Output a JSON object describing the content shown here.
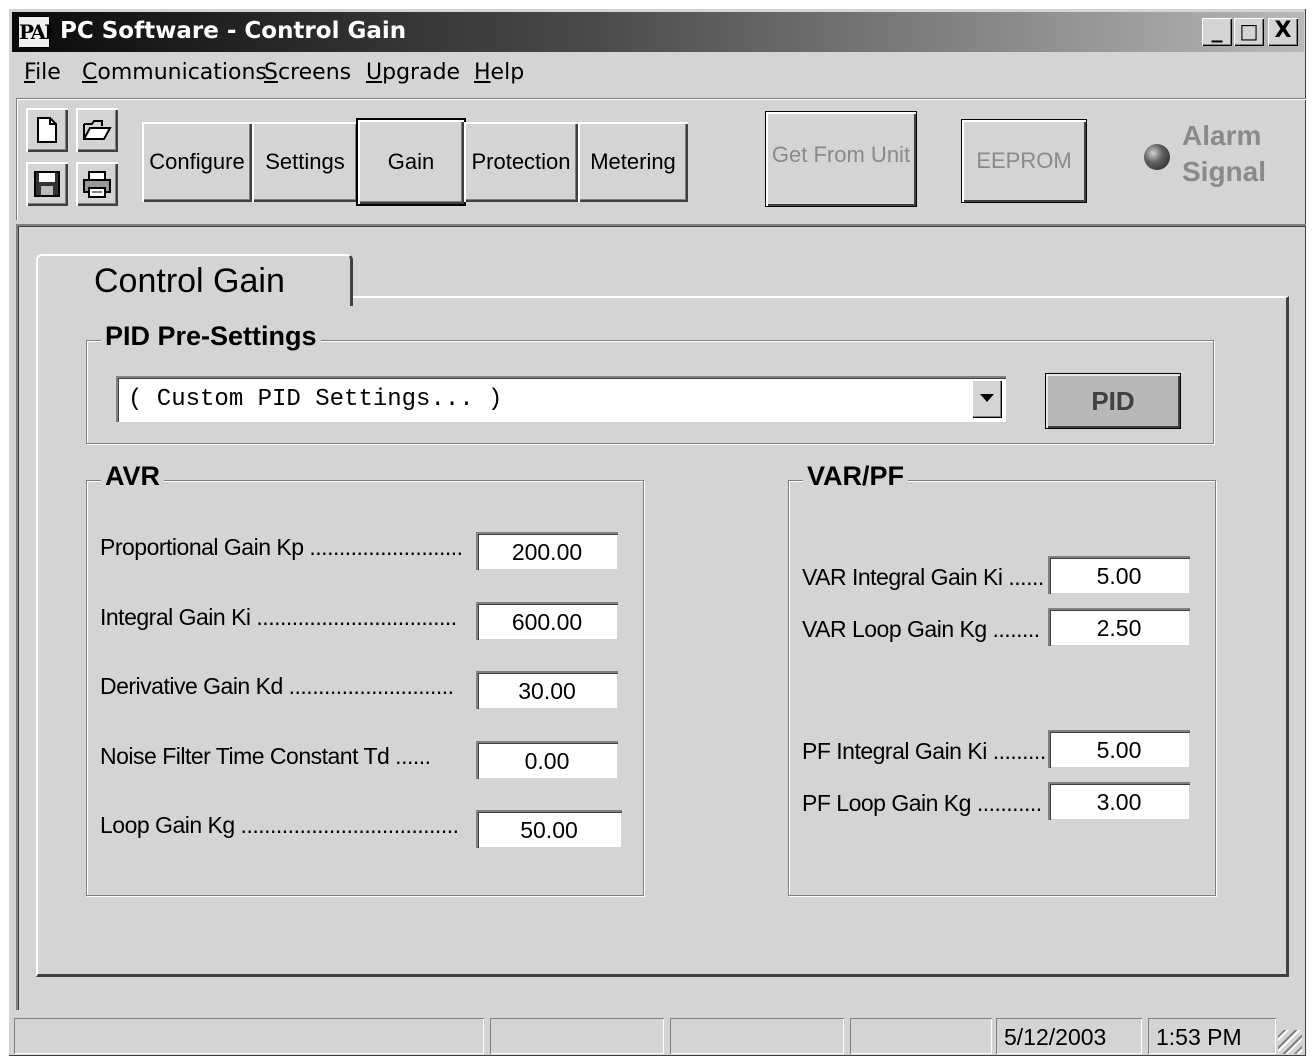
{
  "window": {
    "title": "PC Software - Control Gain",
    "icon_text": "PAI",
    "controls": {
      "minimize": "_",
      "maximize": "□",
      "close": "X"
    }
  },
  "menu": [
    {
      "label_first": "F",
      "label_rest": "ile"
    },
    {
      "label_first": "C",
      "label_rest": "ommunications"
    },
    {
      "label_first": "S",
      "label_rest": "creens"
    },
    {
      "label_first": "U",
      "label_rest": "pgrade"
    },
    {
      "label_first": "H",
      "label_rest": "elp"
    }
  ],
  "toolbar": {
    "icons": [
      "new-file-icon",
      "open-folder-icon",
      "save-disk-icon",
      "printer-icon"
    ],
    "nav_buttons": [
      "Configure",
      "Settings",
      "Gain",
      "Protection",
      "Metering"
    ],
    "active_nav": "Gain",
    "get_from_unit": "Get From Unit",
    "eeprom": "EEPROM",
    "alarm_line1": "Alarm",
    "alarm_line2": "Signal"
  },
  "tab": {
    "label": "Control Gain"
  },
  "pid_presettings": {
    "group_label": "PID Pre-Settings",
    "selected": "( Custom PID Settings... )",
    "button": "PID"
  },
  "avr": {
    "group_label": "AVR",
    "fields": [
      {
        "label": "Proportional Gain Kp ..........................",
        "value": "200.00"
      },
      {
        "label": "Integral Gain Ki ..................................",
        "value": "600.00"
      },
      {
        "label": "Derivative Gain Kd ............................",
        "value": "30.00"
      },
      {
        "label": "Noise Filter Time Constant Td ......",
        "value": "0.00"
      },
      {
        "label": "Loop Gain Kg .....................................",
        "value": "50.00"
      }
    ]
  },
  "varpf": {
    "group_label": "VAR/PF",
    "fields": [
      {
        "label": "VAR Integral Gain Ki ......",
        "value": "5.00"
      },
      {
        "label": "VAR Loop Gain Kg ........",
        "value": "2.50"
      },
      {
        "label": "PF Integral Gain Ki .........",
        "value": "5.00"
      },
      {
        "label": "PF Loop Gain Kg ...........",
        "value": "3.00"
      }
    ]
  },
  "statusbar": {
    "date": "5/12/2003",
    "time": "1:53 PM"
  },
  "colors": {
    "face": "#d4d4d4",
    "disabled_text": "#8a8a8a",
    "title_dark": "#0a0a0a"
  }
}
